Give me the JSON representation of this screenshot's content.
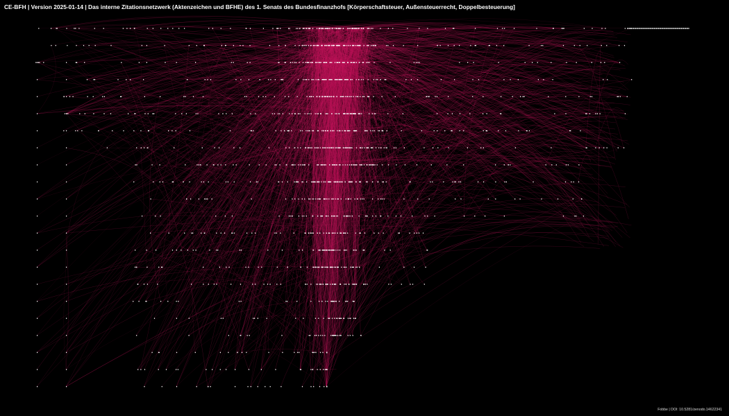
{
  "header": {
    "title": "CE-BFH | Version 2025-01-14 | Das interne Zitationsnetzwerk (Aktenzeichen und BFHE) des 1. Senats des Bundesfinanzhofs [Körperschaftsteuer, Außensteuerrecht, Doppelbesteuerung]"
  },
  "footer": {
    "credit": "Fobbe | DOI: 10.5281/zenodo.14622341"
  },
  "colors": {
    "background": "#000000",
    "edge": "#c0145a",
    "node": "#ffffff",
    "text": "#ffffff"
  }
}
